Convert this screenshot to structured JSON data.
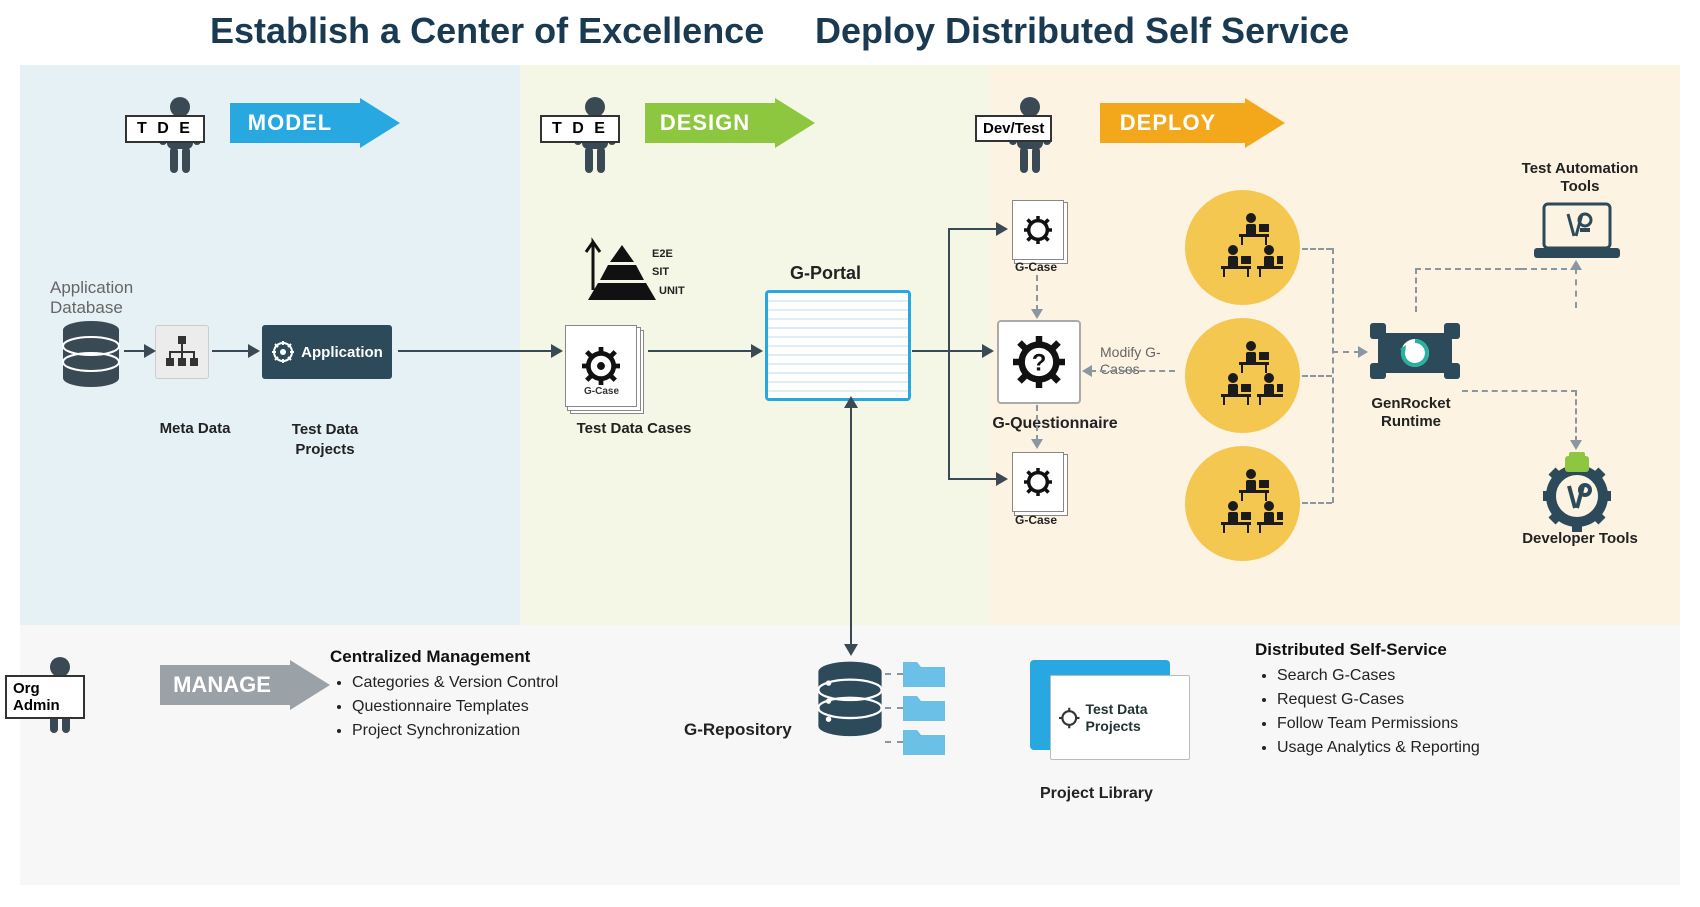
{
  "titles": {
    "left": "Establish a Center of Excellence",
    "right": "Deploy Distributed Self Service"
  },
  "stages": {
    "model": {
      "role": "T D E",
      "label": "MODEL",
      "color": "#28a8e0"
    },
    "design": {
      "role": "T D E",
      "label": "DESIGN",
      "color": "#8dc63f"
    },
    "deploy": {
      "role": "Dev/Test",
      "label": "DEPLOY",
      "color": "#f3a71b"
    },
    "manage": {
      "role": "Org Admin",
      "label": "MANAGE",
      "color": "#9aa2a8"
    }
  },
  "labels": {
    "app_db": "Application Database",
    "meta": "Meta Data",
    "projects": "Test Data Projects",
    "app_box": "Application",
    "tdc": "Test Data Cases",
    "pyramid": {
      "top": "E2E",
      "mid": "SIT",
      "bot": "UNIT"
    },
    "gportal": "G-Portal",
    "gcase": "G-Case",
    "gq": "G-Questionnaire",
    "modify": "Modify G-Cases",
    "runtime": "GenRocket Runtime",
    "testauto": "Test Automation Tools",
    "devtools": "Developer Tools",
    "grepo": "G-Repository",
    "projlib_card": "Test Data Projects",
    "projlib": "Project Library"
  },
  "manage": {
    "title": "Centralized Management",
    "items": [
      "Categories & Version Control",
      "Questionnaire Templates",
      "Project Synchronization"
    ]
  },
  "selfservice": {
    "title": "Distributed Self-Service",
    "items": [
      "Search G-Cases",
      "Request G-Cases",
      "Follow Team Permissions",
      "Usage Analytics & Reporting"
    ]
  }
}
